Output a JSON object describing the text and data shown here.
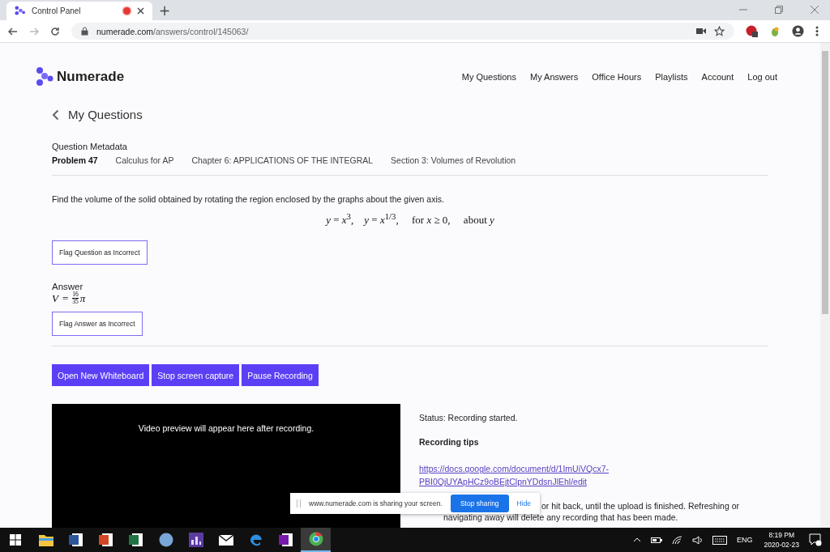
{
  "browser": {
    "tab": {
      "title": "Control Panel",
      "recording": true
    },
    "new_tab": "+",
    "address": {
      "host": "numerade.com",
      "path": "/answers/control/145063/"
    }
  },
  "site": {
    "logo": "Numerade",
    "nav": [
      "My Questions",
      "My Answers",
      "Office Hours",
      "Playlists",
      "Account",
      "Log out"
    ]
  },
  "back": {
    "label": "My Questions"
  },
  "metadata": {
    "heading": "Question Metadata",
    "problem": "Problem 47",
    "book": "Calculus for AP",
    "chapter": "Chapter 6: APPLICATIONS OF THE INTEGRAL",
    "section": "Section 3: Volumes of Revolution"
  },
  "question": {
    "text": "Find the volume of the solid obtained by rotating the region enclosed by the graphs about the given axis.",
    "math": "*y* = *x*$^{3}$,    *y* = *x*$^{1/3}$,     for *x* ≥ 0,     about *y*",
    "flag": "Flag Question as Incorrect"
  },
  "answer": {
    "heading": "Answer",
    "variable": "V",
    "relation": "=",
    "numerator": "16",
    "denominator": "35",
    "symbol": "π",
    "flag": "Flag Answer as Incorrect"
  },
  "actions": [
    "Open New Whiteboard",
    "Stop screen capture",
    "Pause Recording"
  ],
  "preview": {
    "message": "Video preview will appear here after recording."
  },
  "status": "Status: Recording started.",
  "tips": {
    "heading": "Recording tips",
    "link": "https://docs.google.com/document/d/1ImUiVQcx7-PBI0QjUYApHCz9oBEjtClpnYDdsnJlEhl/edit",
    "note_line_1": "or hit back, until the upload is finished. Refreshing or",
    "note_line_2": "navigating away will delete any recording that has been made."
  },
  "sharing_bar": {
    "message": "www.numerade.com is sharing your screen.",
    "stop": "Stop sharing",
    "hide": "Hide"
  },
  "taskbar": {
    "apps": [
      {
        "kind": "explorer",
        "active": false
      },
      {
        "kind": "word",
        "active": false
      },
      {
        "kind": "powerpoint",
        "active": false
      },
      {
        "kind": "excel",
        "active": false
      },
      {
        "kind": "r",
        "active": false
      },
      {
        "kind": "visualizer",
        "active": false
      },
      {
        "kind": "mail",
        "active": false
      },
      {
        "kind": "edge",
        "active": false
      },
      {
        "kind": "onenote",
        "active": false
      },
      {
        "kind": "chrome",
        "active": true
      }
    ],
    "language": "ENG",
    "time": "8:19 PM",
    "date": "2020-02-23"
  }
}
